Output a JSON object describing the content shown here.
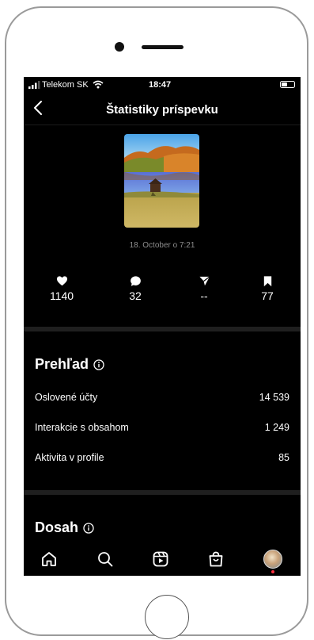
{
  "status_bar": {
    "carrier": "Telekom SK",
    "time": "18:47",
    "battery_level": 0.45
  },
  "header": {
    "title": "Štatistiky príspevku",
    "back_icon": "chevron-left-icon"
  },
  "post": {
    "date": "18. October o 7:21"
  },
  "stats": {
    "likes": "1140",
    "comments": "32",
    "shares": "--",
    "saves": "77"
  },
  "overview": {
    "title": "Prehľad",
    "rows": [
      {
        "label": "Oslovené účty",
        "value": "14 539"
      },
      {
        "label": "Interakcie s obsahom",
        "value": "1 249"
      },
      {
        "label": "Aktivita v profile",
        "value": "85"
      }
    ]
  },
  "reach": {
    "title": "Dosah"
  },
  "tabs": [
    "home-icon",
    "search-icon",
    "reels-icon",
    "shop-icon",
    "profile-avatar"
  ],
  "colors": {
    "background": "#000000",
    "text": "#ffffff",
    "muted": "#8e8e8e",
    "divider": "#1f1f1f",
    "notification": "#ff3040"
  }
}
